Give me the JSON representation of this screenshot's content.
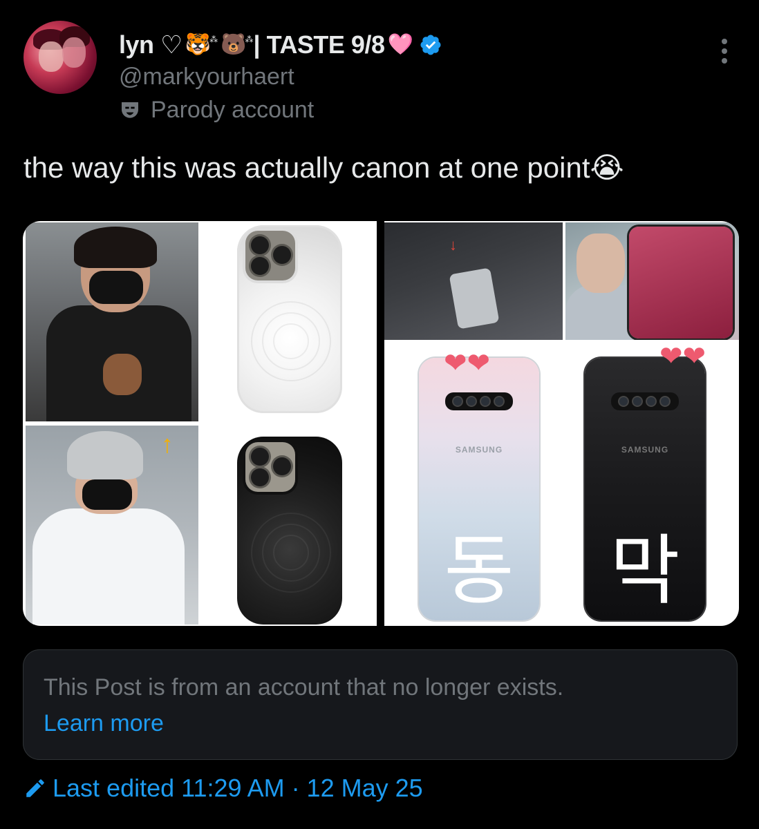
{
  "author": {
    "display_name": "lyn ♡",
    "name_emoji_1": "🐯",
    "name_emoji_2": "🐻",
    "name_suffix": "| TASTE 9/8",
    "heart_emoji": "🩷",
    "handle": "@markyourhaert",
    "label": "Parody account",
    "verified_color": "#1d9bf0"
  },
  "tweet": {
    "text": "the way this was actually canon at one point",
    "emoji": "😭"
  },
  "media": {
    "brand_left": "SAMSUNG",
    "brand_right": "SAMSUNG",
    "korean_left": "동",
    "korean_right": "막",
    "heart_color": "#ee5a6f"
  },
  "notice": {
    "text": "This Post is from an account that no longer exists.",
    "link": "Learn more"
  },
  "footer": {
    "edited": "Last edited 11:29 AM · 12 May 25"
  },
  "colors": {
    "background": "#000000",
    "text": "#e7e9ea",
    "secondary": "#71767b",
    "link": "#1d9bf0"
  }
}
